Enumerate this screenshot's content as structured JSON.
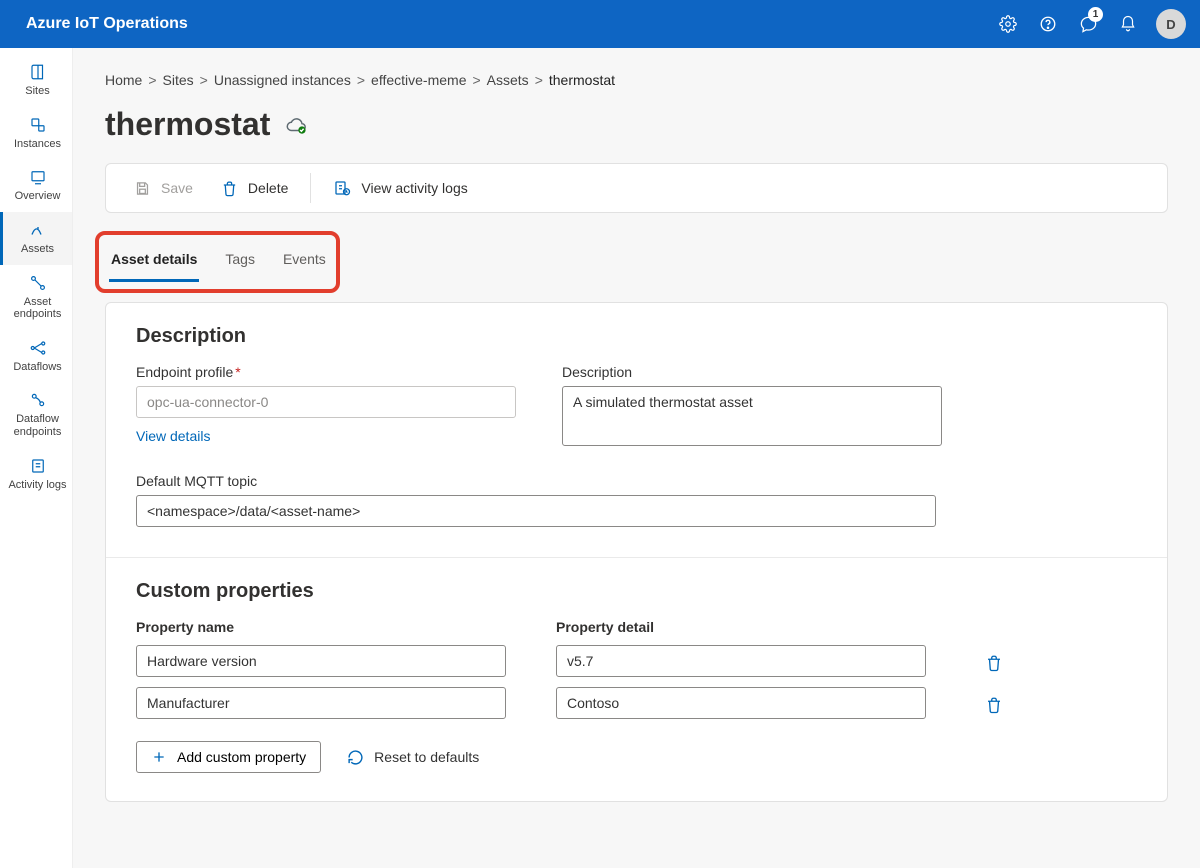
{
  "header": {
    "brand": "Azure IoT Operations",
    "badge_count": "1",
    "avatar_initial": "D"
  },
  "sidebar": {
    "items": [
      {
        "id": "sites",
        "label": "Sites"
      },
      {
        "id": "instances",
        "label": "Instances"
      },
      {
        "id": "overview",
        "label": "Overview"
      },
      {
        "id": "assets",
        "label": "Assets"
      },
      {
        "id": "asset-endpoints",
        "label": "Asset endpoints"
      },
      {
        "id": "dataflows",
        "label": "Dataflows"
      },
      {
        "id": "dataflow-endpoints",
        "label": "Dataflow endpoints"
      },
      {
        "id": "activity-logs",
        "label": "Activity logs"
      }
    ]
  },
  "breadcrumb": {
    "items": [
      "Home",
      "Sites",
      "Unassigned instances",
      "effective-meme",
      "Assets"
    ],
    "current": "thermostat"
  },
  "page": {
    "title": "thermostat"
  },
  "cmdbar": {
    "save": "Save",
    "delete": "Delete",
    "activity": "View activity logs"
  },
  "tabs": {
    "items": [
      {
        "id": "asset-details",
        "label": "Asset details",
        "active": true
      },
      {
        "id": "tags",
        "label": "Tags"
      },
      {
        "id": "events",
        "label": "Events"
      }
    ]
  },
  "details": {
    "section_title": "Description",
    "endpoint_label": "Endpoint profile",
    "endpoint_value": "opc-ua-connector-0",
    "view_details": "View details",
    "description_label": "Description",
    "description_value": "A simulated thermostat asset",
    "mqtt_label": "Default MQTT topic",
    "mqtt_value": "<namespace>/data/<asset-name>"
  },
  "custom": {
    "section_title": "Custom properties",
    "name_header": "Property name",
    "detail_header": "Property detail",
    "rows": [
      {
        "name": "Hardware version",
        "detail": "v5.7"
      },
      {
        "name": "Manufacturer",
        "detail": "Contoso"
      }
    ],
    "add_label": "Add custom property",
    "reset_label": "Reset to defaults"
  }
}
